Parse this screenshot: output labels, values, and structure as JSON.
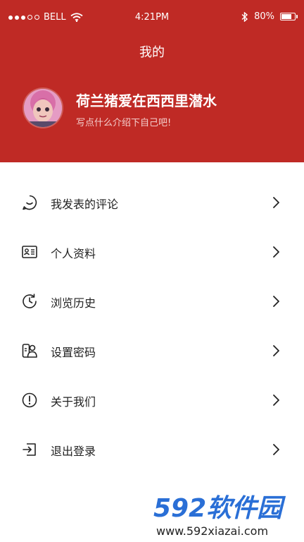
{
  "status_bar": {
    "carrier": "BELL",
    "time": "4:21PM",
    "battery": "80%",
    "battery_level": 0.8
  },
  "header": {
    "title": "我的",
    "username": "荷兰猪爱在西西里潜水",
    "bio": "写点什么介绍下自己吧!"
  },
  "menu": {
    "items": [
      {
        "label": "我发表的评论",
        "icon": "comment-bubble-icon"
      },
      {
        "label": "个人资料",
        "icon": "id-card-icon"
      },
      {
        "label": "浏览历史",
        "icon": "history-clock-icon"
      },
      {
        "label": "设置密码",
        "icon": "user-lock-icon"
      },
      {
        "label": "关于我们",
        "icon": "info-circle-icon"
      },
      {
        "label": "退出登录",
        "icon": "logout-icon"
      }
    ]
  },
  "watermark": {
    "brand": "592软件园",
    "url": "www.592xiazai.com"
  },
  "colors": {
    "header_bg": "#bf2a25",
    "text": "#222222",
    "watermark_blue": "#2a6fd6"
  }
}
